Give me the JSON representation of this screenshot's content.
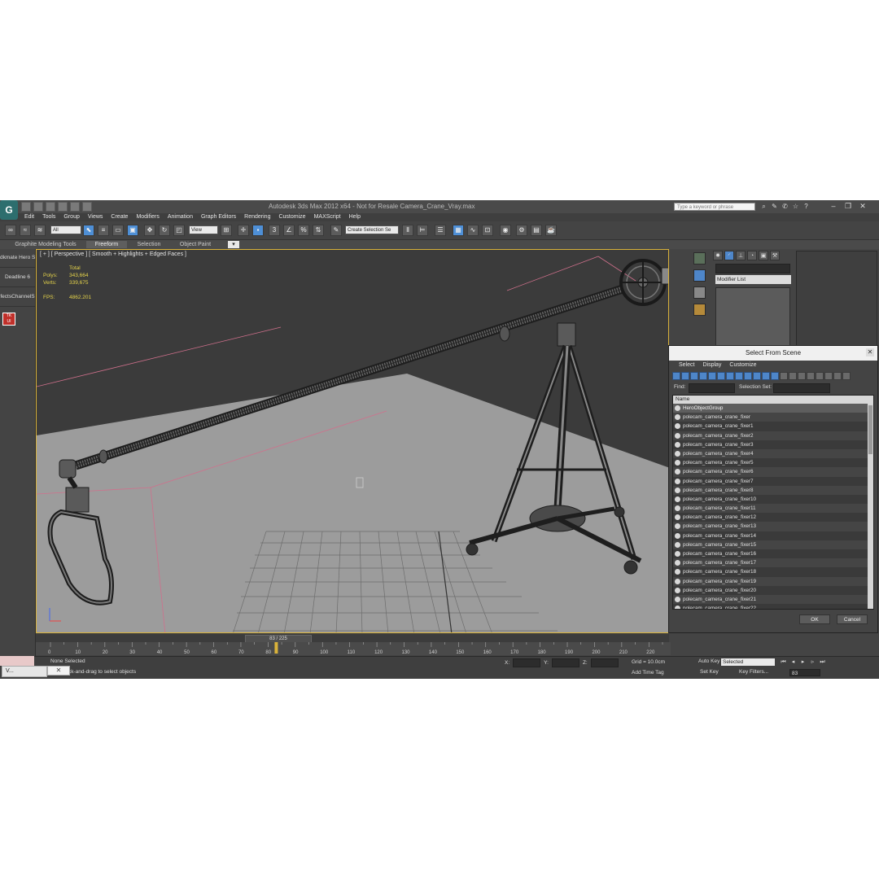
{
  "window": {
    "title": "Autodesk 3ds Max 2012 x64 - Not for Resale   Camera_Crane_Vray.max",
    "search_placeholder": "Type a keyword or phrase",
    "logo_letter": "G"
  },
  "menu": [
    "Edit",
    "Tools",
    "Group",
    "Views",
    "Create",
    "Modifiers",
    "Animation",
    "Graph Editors",
    "Rendering",
    "Customize",
    "MAXScript",
    "Help"
  ],
  "toolbar": {
    "filter_select": "All",
    "ref_coord_select": "View",
    "selection_set_select": "Create Selection Se"
  },
  "ribbon_tabs": [
    "Graphite Modeling Tools",
    "Freeform",
    "Selection",
    "Object Paint"
  ],
  "left_panel": [
    "dkmate Hero S",
    "Deadline 6",
    "fectsChannelS"
  ],
  "viewport": {
    "label": "[ + ] [ Perspective ] [ Smooth + Highlights + Edged Faces ]",
    "stats": {
      "total_label": "Total",
      "polys_label": "Polys:",
      "polys": "343,664",
      "verts_label": "Verts:",
      "verts": "339,675",
      "fps_label": "FPS:",
      "fps": "4862.201"
    }
  },
  "command_panel": {
    "modifier_list": "Modifier List"
  },
  "dialog": {
    "title": "Select From Scene",
    "menu": [
      "Select",
      "Display",
      "Customize"
    ],
    "find_label": "Find:",
    "selset_label": "Selection Set:",
    "column_header": "Name",
    "rows": [
      "HeroObjectGroup",
      "polecam_camera_crane_fixer",
      "polecam_camera_crane_fixer1",
      "polecam_camera_crane_fixer2",
      "polecam_camera_crane_fixer3",
      "polecam_camera_crane_fixer4",
      "polecam_camera_crane_fixer5",
      "polecam_camera_crane_fixer6",
      "polecam_camera_crane_fixer7",
      "polecam_camera_crane_fixer8",
      "polecam_camera_crane_fixer10",
      "polecam_camera_crane_fixer11",
      "polecam_camera_crane_fixer12",
      "polecam_camera_crane_fixer13",
      "polecam_camera_crane_fixer14",
      "polecam_camera_crane_fixer15",
      "polecam_camera_crane_fixer16",
      "polecam_camera_crane_fixer17",
      "polecam_camera_crane_fixer18",
      "polecam_camera_crane_fixer19",
      "polecam_camera_crane_fixer20",
      "polecam_camera_crane_fixer21",
      "polecam_camera_crane_fixer22"
    ],
    "ok": "OK",
    "cancel": "Cancel"
  },
  "timeline": {
    "frame_display": "83 / 225",
    "current_frame": 83,
    "total_frames": 225,
    "ticks": [
      "0",
      "10",
      "20",
      "30",
      "40",
      "50",
      "60",
      "70",
      "80",
      "90",
      "100",
      "110",
      "120",
      "130",
      "140",
      "150",
      "160",
      "170",
      "180",
      "190",
      "200",
      "210",
      "220"
    ]
  },
  "status": {
    "selected": "None Selected",
    "prompt": "ck-and-drag to select objects",
    "x_label": "X:",
    "y_label": "Y:",
    "z_label": "Z:",
    "grid": "Grid = 10.0cm",
    "add_time_tag": "Add Time Tag",
    "auto_key": "Auto Key",
    "auto_key_select": "Selected",
    "set_key": "Set Key",
    "key_filters": "Key Filters...",
    "frame": "83"
  },
  "taskbar": {
    "label": "V..."
  },
  "colors": {
    "ui_bg": "#444444",
    "viewport_bg": "#3b3b3b",
    "floor": "#9a9a9a",
    "stats_yellow": "#e5d34a",
    "accent_blue": "#4e8fd6",
    "viewport_border": "#d9b23a"
  }
}
